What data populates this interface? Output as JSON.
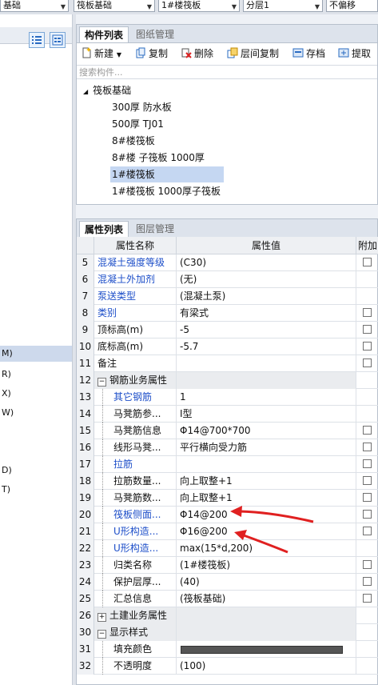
{
  "top_dropdowns": [
    {
      "value": "基础"
    },
    {
      "value": "筏板基础"
    },
    {
      "value": "1#楼筏板"
    },
    {
      "value": "分层1"
    },
    {
      "value": "不偏移"
    }
  ],
  "left_panel": {
    "items": [
      "M)",
      "R)",
      "X)",
      "W)",
      "D)",
      "T)"
    ],
    "selected_index": 0
  },
  "component_panel": {
    "tabs": [
      "构件列表",
      "图纸管理"
    ],
    "active_tab": 0,
    "toolbar": {
      "new_label": "新建",
      "copy_label": "复制",
      "delete_label": "删除",
      "floor_copy_label": "层间复制",
      "save_label": "存档",
      "extract_label": "提取"
    },
    "search_placeholder": "搜索构件...",
    "tree": {
      "root_label": "筏板基础",
      "children": [
        "300厚 防水板",
        "500厚 TJ01",
        "8#楼筏板",
        "8#楼  子筏板 1000厚",
        "1#楼筏板",
        "1#楼筏板 1000厚子筏板"
      ],
      "selected_index": 4
    }
  },
  "property_panel": {
    "tabs": [
      "属性列表",
      "图层管理"
    ],
    "active_tab": 0,
    "columns": [
      "属性名称",
      "属性值",
      "附加"
    ],
    "rows": [
      {
        "num": "5",
        "name": "混凝土强度等级",
        "value": "(C30)",
        "blue": true,
        "check": true
      },
      {
        "num": "6",
        "name": "混凝土外加剂",
        "value": "(无)",
        "blue": true,
        "check": false
      },
      {
        "num": "7",
        "name": "泵送类型",
        "value": "(混凝土泵)",
        "blue": true,
        "check": false
      },
      {
        "num": "8",
        "name": "类别",
        "value": "有梁式",
        "blue": true,
        "check": true
      },
      {
        "num": "9",
        "name": "顶标高(m)",
        "value": "-5",
        "blue": false,
        "check": true
      },
      {
        "num": "10",
        "name": "底标高(m)",
        "value": "-5.7",
        "blue": false,
        "check": true
      },
      {
        "num": "11",
        "name": "备注",
        "value": "",
        "blue": false,
        "check": true
      },
      {
        "num": "12",
        "name": "钢筋业务属性",
        "value": "",
        "group": true,
        "expanded": true
      },
      {
        "num": "13",
        "name": "其它钢筋",
        "value": "1",
        "blue": true,
        "child": true,
        "check": false
      },
      {
        "num": "14",
        "name": "马凳筋参...",
        "value": "Ⅰ型",
        "blue": false,
        "child": true,
        "check": false
      },
      {
        "num": "15",
        "name": "马凳筋信息",
        "value": "Φ14@700*700",
        "blue": false,
        "child": true,
        "check": true
      },
      {
        "num": "16",
        "name": "线形马凳...",
        "value": "平行横向受力筋",
        "blue": false,
        "child": true,
        "check": true
      },
      {
        "num": "17",
        "name": "拉筋",
        "value": "",
        "blue": true,
        "child": true,
        "check": true
      },
      {
        "num": "18",
        "name": "拉筋数量...",
        "value": "向上取整+1",
        "blue": false,
        "child": true,
        "check": true
      },
      {
        "num": "19",
        "name": "马凳筋数...",
        "value": "向上取整+1",
        "blue": false,
        "child": true,
        "check": true
      },
      {
        "num": "20",
        "name": "筏板侧面...",
        "value": "Φ14@200",
        "blue": true,
        "child": true,
        "check": true
      },
      {
        "num": "21",
        "name": "U形构造...",
        "value": "Φ16@200",
        "blue": true,
        "child": true,
        "check": true
      },
      {
        "num": "22",
        "name": "U形构造...",
        "value": "max(15*d,200)",
        "blue": true,
        "child": true,
        "check": false
      },
      {
        "num": "23",
        "name": "归类名称",
        "value": "(1#楼筏板)",
        "blue": false,
        "child": true,
        "check": true
      },
      {
        "num": "24",
        "name": "保护层厚...",
        "value": "(40)",
        "blue": false,
        "child": true,
        "check": true
      },
      {
        "num": "25",
        "name": "汇总信息",
        "value": "(筏板基础)",
        "blue": false,
        "child": true,
        "check": true
      },
      {
        "num": "26",
        "name": "土建业务属性",
        "value": "",
        "group": true,
        "expanded": false
      },
      {
        "num": "30",
        "name": "显示样式",
        "value": "",
        "group": true,
        "expanded": true
      },
      {
        "num": "31",
        "name": "填充颜色",
        "value": "",
        "blue": false,
        "child": true,
        "color": true,
        "check": false
      },
      {
        "num": "32",
        "name": "不透明度",
        "value": "(100)",
        "blue": false,
        "child": true,
        "check": false
      }
    ]
  },
  "colors": {
    "link_blue": "#1e4fc9",
    "selection": "#c5d7f2",
    "annotation_arrow": "#e02020",
    "fill_color": "#555555"
  },
  "icons": [
    "list-view-icon",
    "grid-view-icon",
    "new-icon",
    "copy-icon",
    "delete-icon",
    "floor-copy-icon",
    "save-icon",
    "extract-icon",
    "tree-collapse-icon",
    "expand-icon",
    "collapse-icon",
    "arrow-annotation-icon"
  ]
}
